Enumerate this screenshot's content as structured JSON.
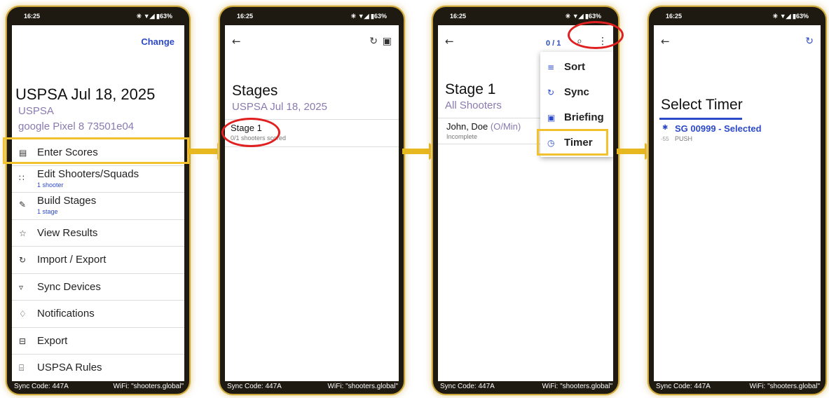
{
  "status_bar": {
    "time": "16:25",
    "indicators": "✳ ▼◢ ▮63%",
    "battery": "63%"
  },
  "footer": {
    "sync_code": "Sync Code: 447A",
    "wifi": "WiFi: \"shooters.global\""
  },
  "colors": {
    "accent_blue": "#2b49c8",
    "highlight_yellow": "#f2c12e",
    "annotation_red": "#e02020",
    "frame_gold": "#c9a43a"
  },
  "screen1": {
    "change_label": "Change",
    "match_title": "USPSA Jul 18, 2025",
    "match_type": "USPSA",
    "device": "google Pixel 8 73501e04",
    "menu": [
      {
        "label": "Enter Scores",
        "sub": "",
        "icon": "calculator-icon",
        "glyph": "▤"
      },
      {
        "label": "Edit Shooters/Squads",
        "sub": "1 shooter",
        "icon": "people-icon",
        "glyph": "∷"
      },
      {
        "label": "Build Stages",
        "sub": "1 stage",
        "icon": "pencil-icon",
        "glyph": "✎"
      },
      {
        "label": "View Results",
        "sub": "",
        "icon": "star-icon",
        "glyph": "☆"
      },
      {
        "label": "Import / Export",
        "sub": "",
        "icon": "sync-icon",
        "glyph": "↻"
      },
      {
        "label": "Sync Devices",
        "sub": "",
        "icon": "wifi-icon",
        "glyph": "▿"
      },
      {
        "label": "Notifications",
        "sub": "",
        "icon": "bell-icon",
        "glyph": "♢"
      },
      {
        "label": "Export",
        "sub": "",
        "icon": "export-icon",
        "glyph": "⊟"
      },
      {
        "label": "USPSA Rules",
        "sub": "",
        "icon": "document-icon",
        "glyph": "⌸"
      }
    ]
  },
  "screen2": {
    "back_glyph": "←",
    "sync_glyph": "↻",
    "doc_glyph": "▣",
    "title": "Stages",
    "subtitle": "USPSA Jul 18, 2025",
    "stages": [
      {
        "name": "Stage 1",
        "detail": "0/1 shooters scored"
      }
    ]
  },
  "screen3": {
    "back_glyph": "←",
    "count": "0 / 1",
    "search_glyph": "⌕",
    "more_glyph": "⋮",
    "title": "Stage 1",
    "subtitle": "All Shooters",
    "shooter_name": "John, Doe",
    "shooter_division": "(O/Min)",
    "shooter_status": "Incomplete",
    "menu": [
      {
        "label": "Sort",
        "icon": "sort-icon",
        "glyph": "≡"
      },
      {
        "label": "Sync",
        "icon": "sync-icon",
        "glyph": "↻"
      },
      {
        "label": "Briefing",
        "icon": "document-icon",
        "glyph": "▣"
      },
      {
        "label": "Timer",
        "icon": "timer-icon",
        "glyph": "◷"
      }
    ]
  },
  "screen4": {
    "back_glyph": "←",
    "refresh_glyph": "↻",
    "title": "Select Timer",
    "timer_name": "SG 00999 - Selected",
    "timer_rssi": "-55",
    "timer_mode": "PUSH",
    "bluetooth_glyph": "✱"
  }
}
